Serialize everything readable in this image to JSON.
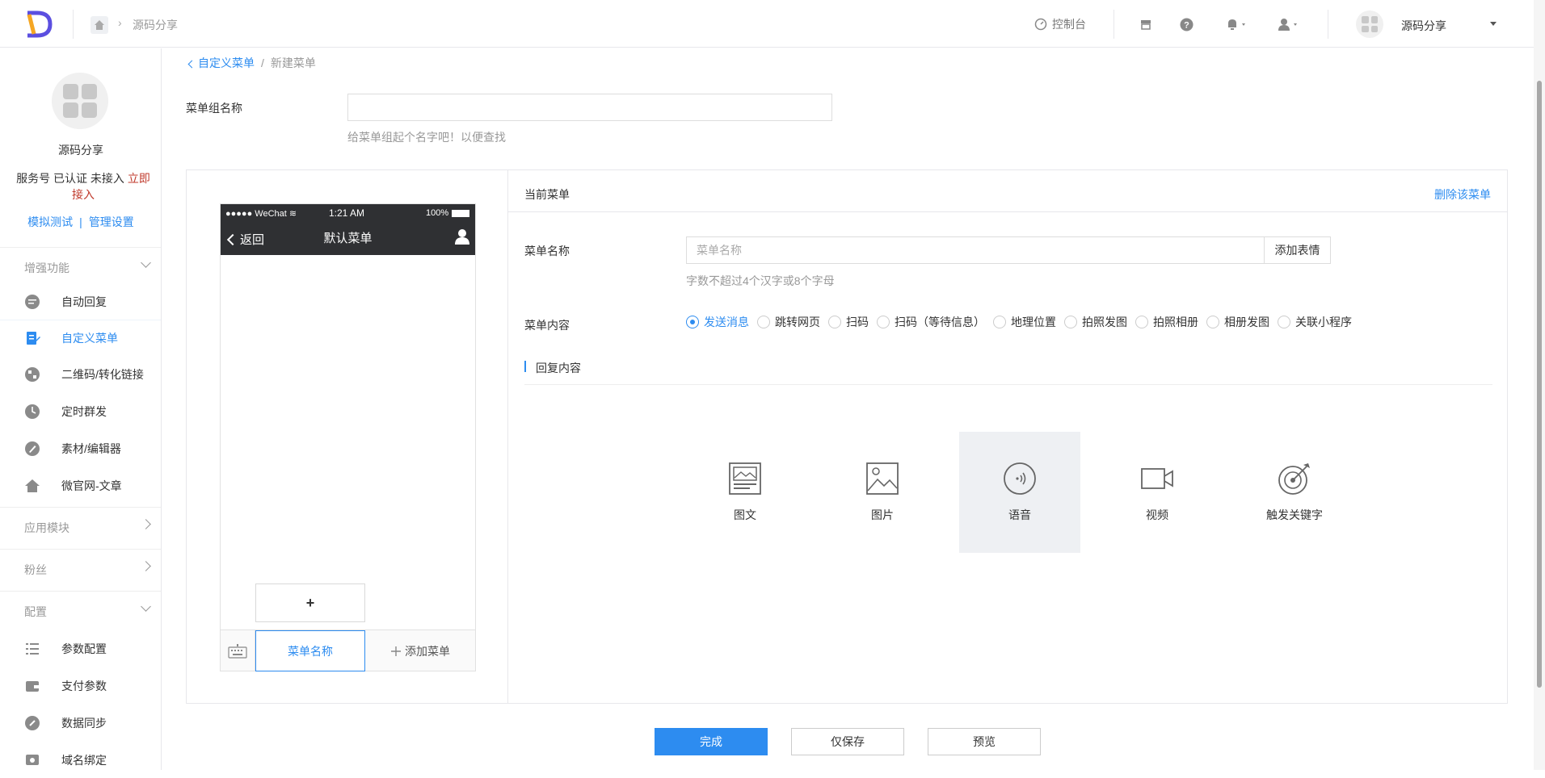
{
  "header": {
    "breadcrumb": "源码分享",
    "console_label": "控制台",
    "account_name": "源码分享"
  },
  "sidebar": {
    "account_name": "源码分享",
    "status_prefix": "服务号 已认证 未接入 ",
    "status_link": "立即接入",
    "link_test": "模拟测试",
    "link_separator": "|",
    "link_manage": "管理设置",
    "sections": {
      "enhanced": "增强功能",
      "app_modules": "应用模块",
      "fans": "粉丝",
      "config": "配置"
    },
    "enhanced_items": [
      {
        "label": "自动回复",
        "icon": "chat-icon"
      },
      {
        "label": "自定义菜单",
        "icon": "edit-doc-icon"
      },
      {
        "label": "二维码/转化链接",
        "icon": "qrcode-icon"
      },
      {
        "label": "定时群发",
        "icon": "clock-icon"
      },
      {
        "label": "素材/编辑器",
        "icon": "pen-icon"
      },
      {
        "label": "微官网-文章",
        "icon": "home-icon"
      }
    ],
    "config_items": [
      {
        "label": "参数配置",
        "icon": "list-icon"
      },
      {
        "label": "支付参数",
        "icon": "wallet-icon"
      },
      {
        "label": "数据同步",
        "icon": "link-icon"
      },
      {
        "label": "域名绑定",
        "icon": "domain-icon"
      }
    ]
  },
  "page": {
    "breadcrumb_back": "自定义菜单",
    "breadcrumb_sep": "/",
    "breadcrumb_current": "新建菜单",
    "group_name_label": "菜单组名称",
    "group_name_value": "",
    "group_name_tip": "给菜单组起个名字吧！以便查找"
  },
  "phone": {
    "status_left": "●●●●● WeChat ≋",
    "status_time": "1:21 AM",
    "status_battery": "100%",
    "back_label": "返回",
    "title": "默认菜单",
    "sub_add": "+",
    "menu_item": "菜单名称",
    "add_menu": "添加菜单"
  },
  "editor": {
    "current_menu": "当前菜单",
    "delete_menu": "删除该菜单",
    "menu_name_label": "菜单名称",
    "menu_name_placeholder": "菜单名称",
    "add_emoji": "添加表情",
    "menu_name_tip": "字数不超过4个汉字或8个字母",
    "menu_content_label": "菜单内容",
    "content_options": [
      {
        "label": "发送消息",
        "checked": true
      },
      {
        "label": "跳转网页",
        "checked": false
      },
      {
        "label": "扫码",
        "checked": false
      },
      {
        "label": "扫码（等待信息）",
        "checked": false
      },
      {
        "label": "地理位置",
        "checked": false
      },
      {
        "label": "拍照发图",
        "checked": false
      },
      {
        "label": "拍照相册",
        "checked": false
      },
      {
        "label": "相册发图",
        "checked": false
      },
      {
        "label": "关联小程序",
        "checked": false
      }
    ],
    "reply_content": "回复内容",
    "reply_types": [
      {
        "label": "图文",
        "icon": "news-icon",
        "selected": false
      },
      {
        "label": "图片",
        "icon": "image-icon",
        "selected": false
      },
      {
        "label": "语音",
        "icon": "voice-icon",
        "selected": true
      },
      {
        "label": "视频",
        "icon": "video-icon",
        "selected": false
      },
      {
        "label": "触发关键字",
        "icon": "target-icon",
        "selected": false
      }
    ]
  },
  "actions": {
    "done": "完成",
    "save_only": "仅保存",
    "preview": "预览"
  },
  "colors": {
    "accent": "#2d8cf0",
    "phone_header": "#2f3033",
    "selected_bg": "#eef0f3"
  }
}
